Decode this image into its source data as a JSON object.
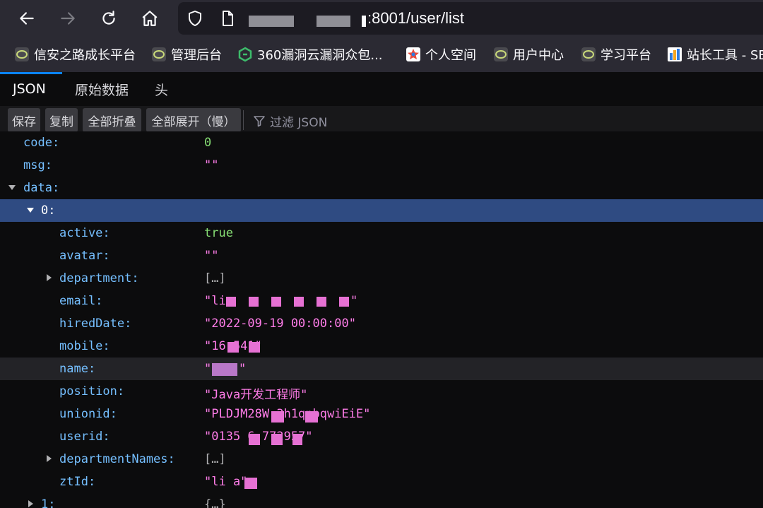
{
  "nav": {
    "url": ":8001/user/list"
  },
  "bookmarks": [
    {
      "label": "信安之路成长平台",
      "icon": "circle-globe-icon"
    },
    {
      "label": "管理后台",
      "icon": "circle-globe-icon"
    },
    {
      "label": "360漏洞云漏洞众包...",
      "icon": "360-logo-icon"
    },
    {
      "label": "个人空间",
      "icon": "star-logo-icon"
    },
    {
      "label": "用户中心",
      "icon": "circle-globe-icon"
    },
    {
      "label": "学习平台",
      "icon": "circle-globe-icon"
    },
    {
      "label": "站长工具 - SE",
      "icon": "chart-logo-icon"
    }
  ],
  "tabs": [
    {
      "label": "JSON",
      "active": true
    },
    {
      "label": "原始数据",
      "active": false
    },
    {
      "label": "头",
      "active": false
    }
  ],
  "toolbar": {
    "save": "保存",
    "copy": "复制",
    "collapse_all": "全部折叠",
    "expand_all": "全部展开（慢）",
    "filter_placeholder": "过滤 JSON"
  },
  "json": {
    "code_key": "code:",
    "code_val": "0",
    "msg_key": "msg:",
    "msg_val": "\"\"",
    "data_key": "data:",
    "item0_key": "0:",
    "active_key": "active:",
    "active_val": "true",
    "avatar_key": "avatar:",
    "avatar_val": "\"\"",
    "department_key": "department:",
    "department_val": "[…]",
    "email_key": "email:",
    "email_val": "\"li",
    "email_tail": "\"",
    "hiredDate_key": "hiredDate:",
    "hiredDate_val": "\"2022-09-19 00:00:00\"",
    "mobile_key": "mobile:",
    "mobile_val": "\"16     541\"",
    "name_key": "name:",
    "name_val": "\"",
    "name_tail": "\"",
    "position_key": "position:",
    "position_val": "\"Java开发工程师\"",
    "unionid_key": "unionid:",
    "unionid_val": "\"PLDJM28W          3h1qnbqwiEiE\"",
    "userid_key": "userid:",
    "userid_val": "\"0135 6        772957\"",
    "departmentNames_key": "departmentNames:",
    "departmentNames_val": "[…]",
    "ztId_key": "ztId:",
    "ztId_val": "\"li     a\"",
    "item1_key": "1:",
    "item1_val": "{…}"
  }
}
